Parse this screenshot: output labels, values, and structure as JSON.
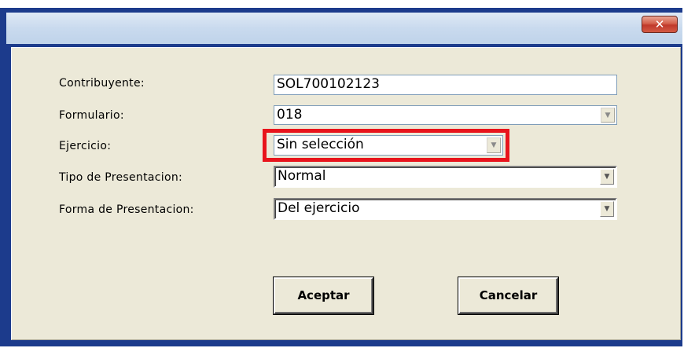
{
  "window": {
    "close_label": "✕"
  },
  "form": {
    "contribuyente": {
      "label": "Contribuyente:",
      "value": "SOL700102123"
    },
    "formulario": {
      "label": "Formulario:",
      "value": "018"
    },
    "ejercicio": {
      "label": "Ejercicio:",
      "value": "Sin selección"
    },
    "tipo_presentacion": {
      "label": "Tipo de Presentacion:",
      "value": "Normal"
    },
    "forma_presentacion": {
      "label": "Forma de Presentacion:",
      "value": "Del ejercicio"
    }
  },
  "buttons": {
    "accept": "Aceptar",
    "cancel": "Cancelar"
  },
  "colors": {
    "highlight": "#e8141c",
    "dialog_bg": "#ece9d8",
    "frame": "#1c3b8c"
  }
}
